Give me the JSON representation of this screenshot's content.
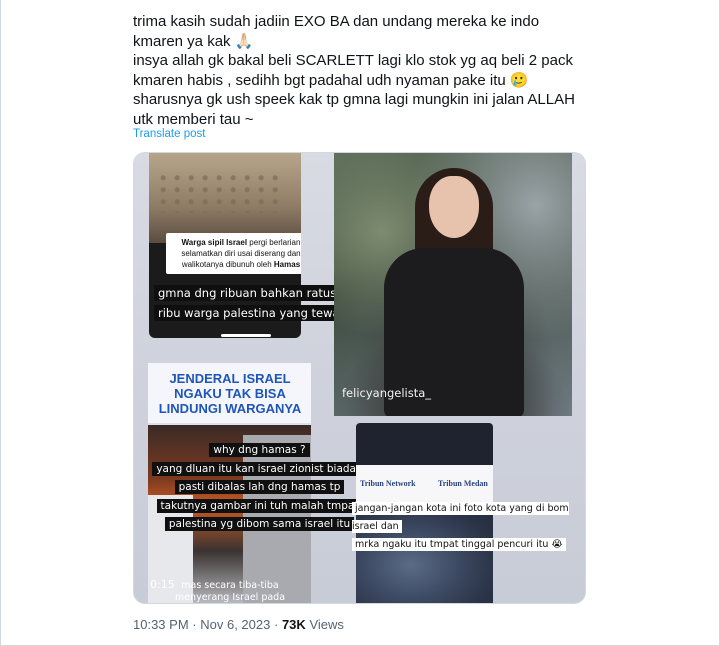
{
  "tweet": {
    "lines": [
      "trima kasih sudah jadiin EXO BA dan undang mereka ke indo kmaren ya kak 🙏🏻",
      "insya allah gk bakal beli SCARLETT lagi klo stok yg aq beli 2 pack kmaren habis , sedihh bgt padahal udh nyaman pake itu 🥲",
      "sharusnya gk ush speek kak tp gmna lagi mungkin ini jalan ALLAH utk memberi tau ~"
    ],
    "translate_label": "Translate post"
  },
  "media": {
    "panel1": {
      "caption_bold1": "Warga sipil Israel",
      "caption_rest": "pergi berlarian selamatkan diri usai diserang dan walikotanya dibunuh oleh",
      "caption_bold2": "Hamas",
      "overlay_lines": [
        "gmna dng ribuan bahkan ratusan",
        "ribu warga palestina yang tewas ?"
      ]
    },
    "panel2": {
      "handle": "felicyangelista_"
    },
    "panel3": {
      "headline": "JENDERAL ISRAEL NGAKU TAK BISA LINDUNGI WARGANYA",
      "overlay_lines": [
        "why dng hamas ?",
        "yang dluan itu kan israel zionist biadab",
        "pasti dibalas lah dng hamas tp",
        "takutnya gambar ini tuh malah tmpat",
        "palestina yg dibom sama israel itu"
      ],
      "time": "0:15",
      "subtitle": "mas secara tiba-tiba menyerang Israel pada"
    },
    "panel4": {
      "logo1": "Tribun Network",
      "logo2": "Tribun Medan",
      "overlay_lines": [
        "jangan-jangan kota ini foto kota yang di bom israel dan",
        "mrka ngaku itu tmpat tinggal pencuri itu 😭"
      ]
    }
  },
  "footer": {
    "time": "10:33 PM",
    "separator": "·",
    "date": "Nov 6, 2023",
    "views_count": "73K",
    "views_label": "Views"
  }
}
